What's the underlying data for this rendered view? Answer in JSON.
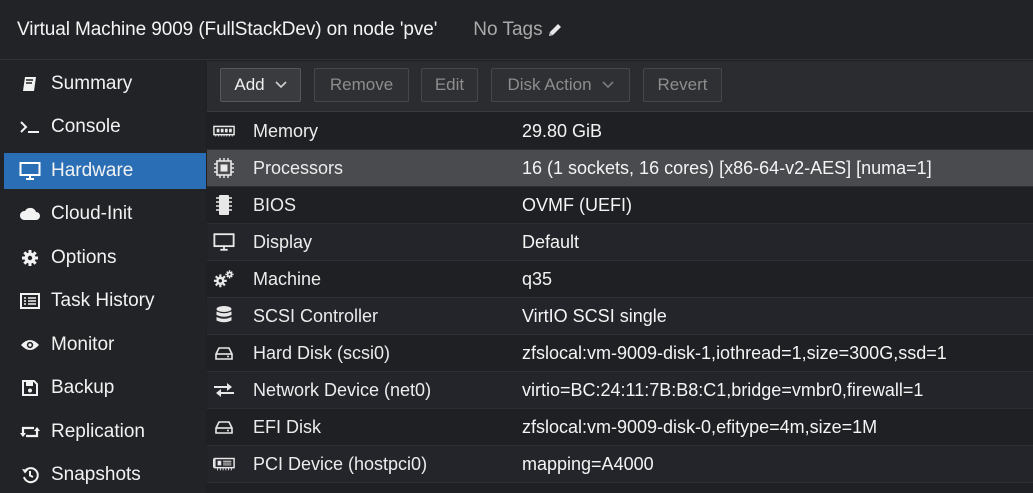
{
  "header": {
    "title": "Virtual Machine 9009 (FullStackDev) on node 'pve'",
    "tags_label": "No Tags"
  },
  "sidebar": {
    "items": [
      {
        "label": "Summary",
        "icon": "book-icon"
      },
      {
        "label": "Console",
        "icon": "terminal-icon"
      },
      {
        "label": "Hardware",
        "icon": "monitor-icon",
        "active": true
      },
      {
        "label": "Cloud-Init",
        "icon": "cloud-icon"
      },
      {
        "label": "Options",
        "icon": "gear-icon"
      },
      {
        "label": "Task History",
        "icon": "list-icon"
      },
      {
        "label": "Monitor",
        "icon": "eye-icon"
      },
      {
        "label": "Backup",
        "icon": "floppy-icon"
      },
      {
        "label": "Replication",
        "icon": "retweet-icon"
      },
      {
        "label": "Snapshots",
        "icon": "history-icon"
      }
    ]
  },
  "toolbar": {
    "add": "Add",
    "remove": "Remove",
    "edit": "Edit",
    "disk_action": "Disk Action",
    "revert": "Revert"
  },
  "hardware": {
    "rows": [
      {
        "name": "Memory",
        "value": "29.80 GiB",
        "icon": "memory-icon"
      },
      {
        "name": "Processors",
        "value": "16 (1 sockets, 16 cores) [x86-64-v2-AES] [numa=1]",
        "icon": "cpu-icon",
        "selected": true
      },
      {
        "name": "BIOS",
        "value": "OVMF (UEFI)",
        "icon": "microchip-icon"
      },
      {
        "name": "Display",
        "value": "Default",
        "icon": "desktop-icon"
      },
      {
        "name": "Machine",
        "value": "q35",
        "icon": "cogs-icon"
      },
      {
        "name": "SCSI Controller",
        "value": "VirtIO SCSI single",
        "icon": "database-icon"
      },
      {
        "name": "Hard Disk (scsi0)",
        "value": "zfslocal:vm-9009-disk-1,iothread=1,size=300G,ssd=1",
        "icon": "hdd-icon"
      },
      {
        "name": "Network Device (net0)",
        "value": "virtio=BC:24:11:7B:B8:C1,bridge=vmbr0,firewall=1",
        "icon": "exchange-icon"
      },
      {
        "name": "EFI Disk",
        "value": "zfslocal:vm-9009-disk-0,efitype=4m,size=1M",
        "icon": "hdd-icon"
      },
      {
        "name": "PCI Device (hostpci0)",
        "value": "mapping=A4000",
        "icon": "pci-card-icon"
      }
    ]
  },
  "colors": {
    "accent": "#2a6fb5",
    "selected_row": "#4a4b4f",
    "background": "#1f2023"
  }
}
